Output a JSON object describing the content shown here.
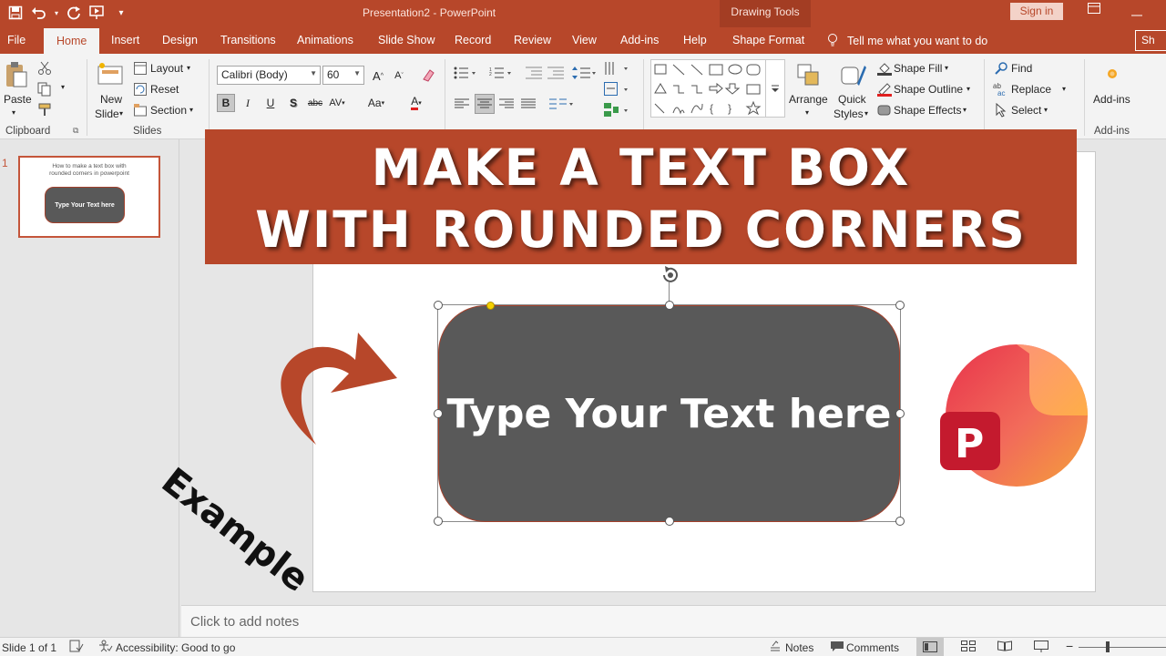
{
  "window": {
    "doc_title": "Presentation2  -  PowerPoint",
    "contextual_group": "Drawing Tools",
    "sign_in": "Sign in",
    "share": "Sh"
  },
  "tabs": [
    "File",
    "Home",
    "Insert",
    "Design",
    "Transitions",
    "Animations",
    "Slide Show",
    "Record",
    "Review",
    "View",
    "Add-ins",
    "Help",
    "Shape Format"
  ],
  "tell_me": "Tell me what you want to do",
  "ribbon": {
    "clipboard": {
      "paste": "Paste",
      "label": "Clipboard"
    },
    "slides": {
      "new_slide_1": "New",
      "new_slide_2": "Slide",
      "layout": "Layout",
      "reset": "Reset",
      "section": "Section",
      "label": "Slides"
    },
    "font": {
      "name": "Calibri (Body)",
      "size": "60",
      "bold": "B",
      "italic": "I",
      "underline": "U",
      "shadow": "S",
      "strike": "abc",
      "spacing": "AV",
      "case": "Aa",
      "color": "A",
      "grow": "A",
      "shrink": "A"
    },
    "drawing": {
      "arrange": "Arrange",
      "quick_styles_1": "Quick",
      "quick_styles_2": "Styles",
      "shape_fill": "Shape Fill",
      "shape_outline": "Shape Outline",
      "shape_effects": "Shape Effects"
    },
    "editing": {
      "find": "Find",
      "replace": "Replace",
      "select": "Select"
    },
    "addins": {
      "button": "Add-ins",
      "label": "Add-ins"
    }
  },
  "slides_pane": {
    "slide_number": "1",
    "thumb_title": "How to make a text box with rounded corners in powerpoint",
    "thumb_box_text": "Type Your Text here"
  },
  "banner": {
    "line1": "MAKE A TEXT BOX",
    "line2": "WITH ROUNDED CORNERS"
  },
  "slide": {
    "box_text": "Type Your Text here",
    "example_label": "Example"
  },
  "notes_placeholder": "Click to add notes",
  "status": {
    "slide_info": "Slide 1 of 1",
    "accessibility": "Accessibility: Good to go",
    "notes": "Notes",
    "comments": "Comments"
  },
  "colors": {
    "accent": "#b7472a",
    "box_fill": "#595959",
    "ribbon_bg": "#f3f3f3"
  }
}
